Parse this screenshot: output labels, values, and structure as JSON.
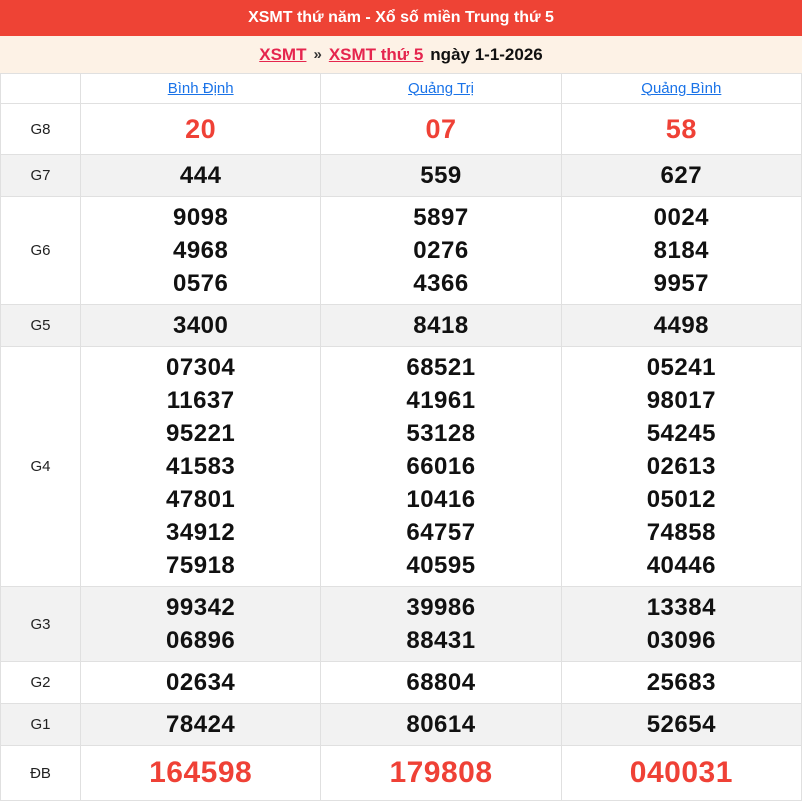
{
  "header": {
    "title": "XSMT thứ năm - Xổ số miền Trung thứ 5"
  },
  "breadcrumb": {
    "link_xsmt": "XSMT",
    "separator": "»",
    "link_day": "XSMT thứ 5",
    "date_text": "ngày 1-1-2026"
  },
  "table": {
    "columns": [
      "Bình Định",
      "Quảng Trị",
      "Quảng Bình"
    ],
    "rows": [
      {
        "key": "g8",
        "label": "G8",
        "style": "g8",
        "cells": [
          [
            "20"
          ],
          [
            "07"
          ],
          [
            "58"
          ]
        ]
      },
      {
        "key": "g7",
        "label": "G7",
        "style": "",
        "cells": [
          [
            "444"
          ],
          [
            "559"
          ],
          [
            "627"
          ]
        ]
      },
      {
        "key": "g6",
        "label": "G6",
        "style": "",
        "cells": [
          [
            "9098",
            "4968",
            "0576"
          ],
          [
            "5897",
            "0276",
            "4366"
          ],
          [
            "0024",
            "8184",
            "9957"
          ]
        ]
      },
      {
        "key": "g5",
        "label": "G5",
        "style": "",
        "cells": [
          [
            "3400"
          ],
          [
            "8418"
          ],
          [
            "4498"
          ]
        ]
      },
      {
        "key": "g4",
        "label": "G4",
        "style": "",
        "cells": [
          [
            "07304",
            "11637",
            "95221",
            "41583",
            "47801",
            "34912",
            "75918"
          ],
          [
            "68521",
            "41961",
            "53128",
            "66016",
            "10416",
            "64757",
            "40595"
          ],
          [
            "05241",
            "98017",
            "54245",
            "02613",
            "05012",
            "74858",
            "40446"
          ]
        ]
      },
      {
        "key": "g3",
        "label": "G3",
        "style": "",
        "cells": [
          [
            "99342",
            "06896"
          ],
          [
            "39986",
            "88431"
          ],
          [
            "13384",
            "03096"
          ]
        ]
      },
      {
        "key": "g2",
        "label": "G2",
        "style": "",
        "cells": [
          [
            "02634"
          ],
          [
            "68804"
          ],
          [
            "25683"
          ]
        ]
      },
      {
        "key": "g1",
        "label": "G1",
        "style": "",
        "cells": [
          [
            "78424"
          ],
          [
            "80614"
          ],
          [
            "52654"
          ]
        ]
      },
      {
        "key": "db",
        "label": "ĐB",
        "style": "db",
        "cells": [
          [
            "164598"
          ],
          [
            "179808"
          ],
          [
            "040031"
          ]
        ]
      }
    ]
  },
  "colors": {
    "header_bg": "#ee4335",
    "breadcrumb_bg": "#fdf2e6",
    "link_red": "#e5254e",
    "link_blue": "#1a73e8",
    "number_red": "#ef4136",
    "stripe_bg": "#f2f2f2",
    "border": "#e0e0e0"
  }
}
